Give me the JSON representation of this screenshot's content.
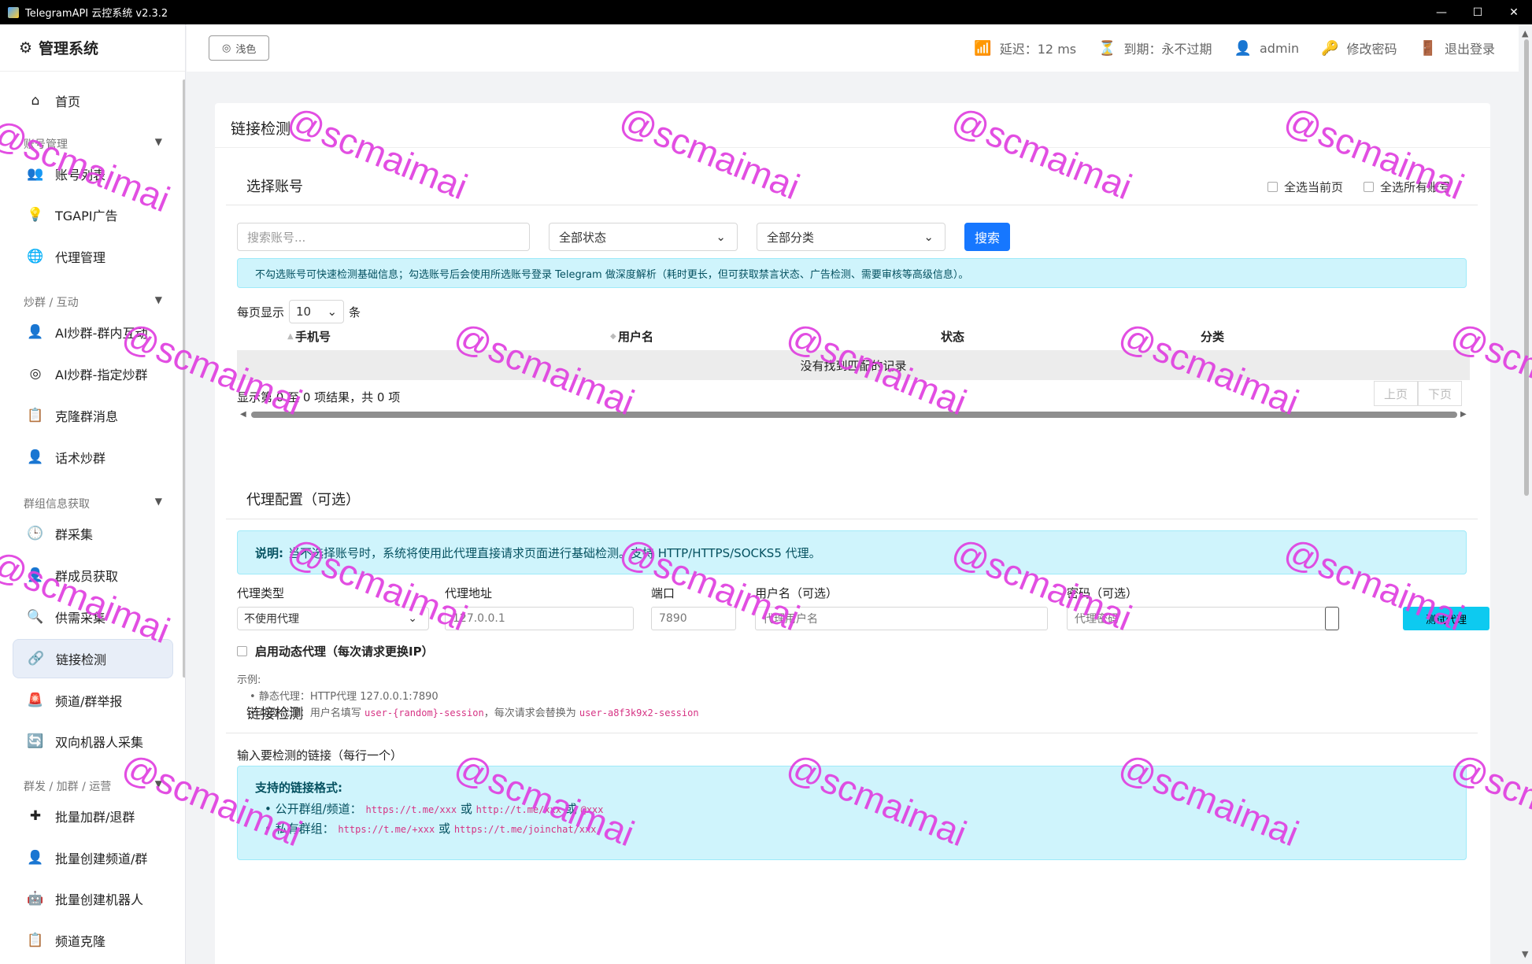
{
  "window": {
    "title": "TelegramAPI 云控系统 v2.3.2",
    "minimize": "—",
    "maximize": "☐",
    "close": "✕"
  },
  "sidebar": {
    "brand": "管理系统",
    "home": "首页",
    "groups": {
      "account": "账号管理",
      "interact": "炒群 / 互动",
      "info": "群组信息获取",
      "ops": "群发 / 加群 / 运营"
    },
    "items": {
      "account_list": "账号列表",
      "tgapi_ad": "TGAPI广告",
      "proxy": "代理管理",
      "ai_group": "AI炒群-群内互动",
      "ai_target": "AI炒群-指定炒群",
      "clone_msg": "克隆群消息",
      "script_group": "话术炒群",
      "group_collect": "群采集",
      "member_fetch": "群成员获取",
      "supply_collect": "供需采集",
      "link_check": "链接检测",
      "report": "频道/群举报",
      "bot_collect": "双向机器人采集",
      "batch_join": "批量加群/退群",
      "batch_create": "批量创建频道/群",
      "batch_bot": "批量创建机器人",
      "channel_clone": "频道克隆"
    }
  },
  "topbar": {
    "theme": "浅色",
    "latency": "延迟：12 ms",
    "expire": "到期：永不过期",
    "user": "admin",
    "change_pwd": "修改密码",
    "logout": "退出登录"
  },
  "main": {
    "card_title": "链接检测",
    "select_account": {
      "title": "选择账号",
      "select_page": "全选当前页",
      "select_all": "全选所有账号",
      "search_placeholder": "搜索账号...",
      "status_filter": "全部状态",
      "category_filter": "全部分类",
      "search_btn": "搜索",
      "tip": "不勾选账号可快速检测基础信息；勾选账号后会使用所选账号登录 Telegram 做深度解析（耗时更长，但可获取禁言状态、广告检测、需要审核等高级信息）。",
      "per_page_prefix": "每页显示",
      "per_page": "10",
      "per_page_suffix": "条",
      "columns": [
        "手机号",
        "用户名",
        "状态",
        "分类"
      ],
      "empty": "没有找到匹配的记录",
      "summary": "显示第 0 至 0 项结果，共 0 项",
      "prev": "上页",
      "next": "下页"
    },
    "proxy": {
      "title": "代理配置（可选）",
      "note_bold": "说明:",
      "note": "当不选择账号时，系统将使用此代理直接请求页面进行基础检测。支持 HTTP/HTTPS/SOCKS5 代理。",
      "type_label": "代理类型",
      "type_value": "不使用代理",
      "addr_label": "代理地址",
      "addr_placeholder": "127.0.0.1",
      "port_label": "端口",
      "port_placeholder": "7890",
      "user_label": "用户名（可选）",
      "user_placeholder": "代理用户名",
      "pwd_label": "密码（可选）",
      "pwd_placeholder": "代理密码",
      "test_btn": "测试代理",
      "dynamic": "启用动态代理（每次请求更换IP）",
      "example_title": "示例:",
      "example1": "静态代理：HTTP代理 127.0.0.1:7890",
      "example2_prefix": "动态代理：用户名填写",
      "example2_code1": "user-{random}-session",
      "example2_mid": "，每次请求会替换为",
      "example2_code2": "user-a8f3k9x2-session"
    },
    "link_check": {
      "title": "链接检测",
      "input_label": "输入要检测的链接（每行一个）",
      "formats_title": "支持的链接格式:",
      "public_label": "公开群组/频道：",
      "public_code1": "https://t.me/xxx",
      "or1": "或",
      "public_code2": "http://t.me/xxx",
      "or2": "或",
      "public_code3": "@xxx",
      "private_label": "私有群组：",
      "private_code1": "https://t.me/+xxx",
      "or3": "或",
      "private_code2": "https://t.me/joinchat/xxx"
    }
  },
  "watermark": "@scmaimai",
  "colors": {
    "primary": "#1677ff",
    "alert_bg": "#cff4fc",
    "cyan_btn": "#0dcaf0",
    "watermark": "#e040e0",
    "code": "#d63384"
  }
}
